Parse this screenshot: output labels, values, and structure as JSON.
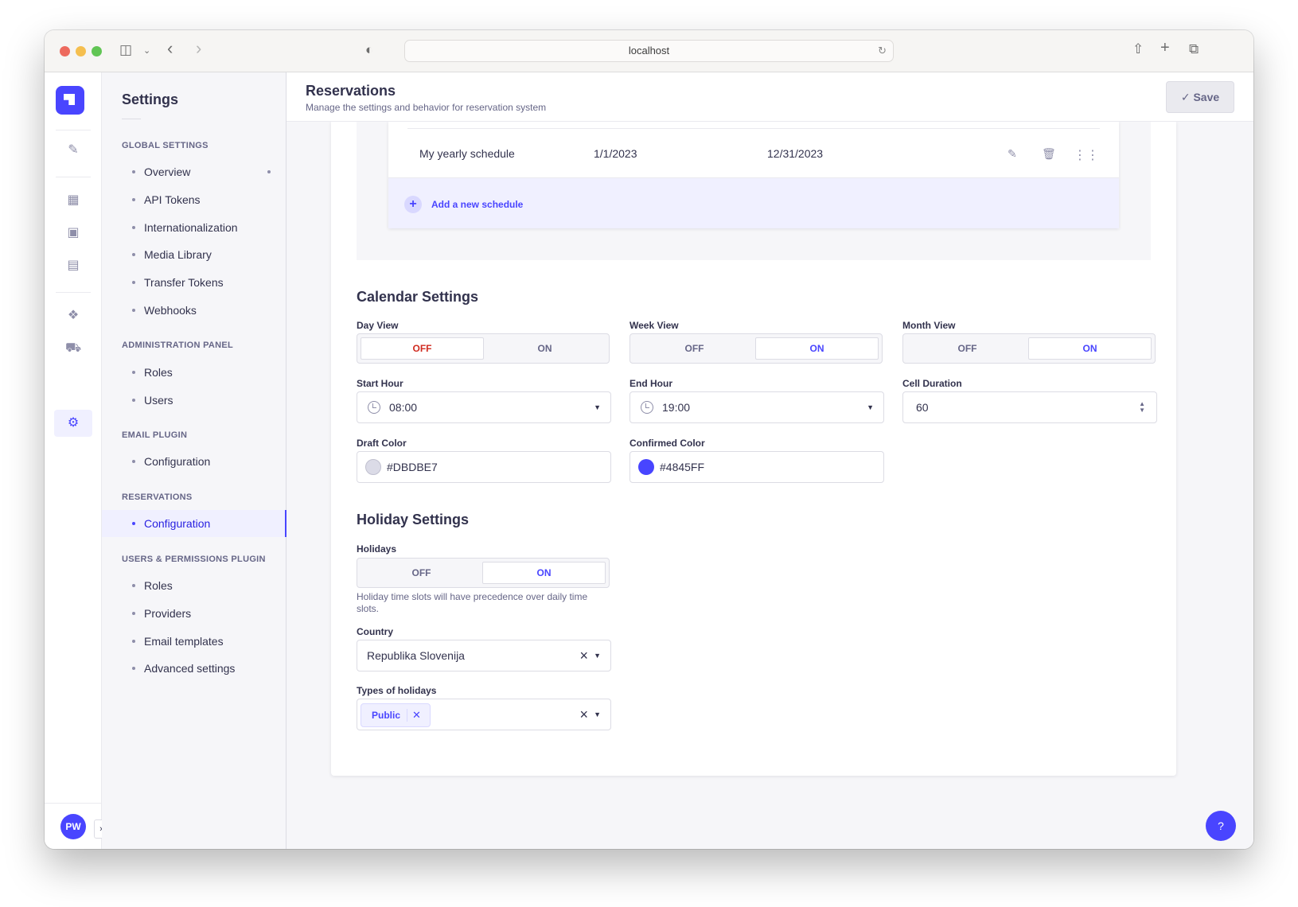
{
  "browser": {
    "url": "localhost"
  },
  "subnav": {
    "title": "Settings",
    "sections": {
      "global": "GLOBAL SETTINGS",
      "admin": "ADMINISTRATION PANEL",
      "email": "EMAIL PLUGIN",
      "reservations": "RESERVATIONS",
      "users_permissions": "USERS & PERMISSIONS PLUGIN"
    },
    "global_items": [
      "Overview",
      "API Tokens",
      "Internationalization",
      "Media Library",
      "Transfer Tokens",
      "Webhooks"
    ],
    "admin_items": [
      "Roles",
      "Users"
    ],
    "email_items": [
      "Configuration"
    ],
    "reservations_items": [
      "Configuration"
    ],
    "up_items": [
      "Roles",
      "Providers",
      "Email templates",
      "Advanced settings"
    ]
  },
  "user": {
    "initials": "PW"
  },
  "header": {
    "title": "Reservations",
    "subtitle": "Manage the settings and behavior for reservation system",
    "save_label": "Save"
  },
  "schedules": {
    "rows": [
      {
        "name": "My yearly schedule",
        "start": "1/1/2023",
        "end": "12/31/2023"
      }
    ],
    "add_label": "Add a new schedule"
  },
  "calendar": {
    "heading": "Calendar Settings",
    "day_view": {
      "label": "Day View",
      "off": "OFF",
      "on": "ON",
      "value": "OFF"
    },
    "week_view": {
      "label": "Week View",
      "off": "OFF",
      "on": "ON",
      "value": "ON"
    },
    "month_view": {
      "label": "Month View",
      "off": "OFF",
      "on": "ON",
      "value": "ON"
    },
    "start_hour": {
      "label": "Start Hour",
      "value": "08:00"
    },
    "end_hour": {
      "label": "End Hour",
      "value": "19:00"
    },
    "cell_duration": {
      "label": "Cell Duration",
      "value": "60"
    },
    "draft_color": {
      "label": "Draft Color",
      "value": "#DBDBE7"
    },
    "confirmed_color": {
      "label": "Confirmed Color",
      "value": "#4845FF"
    }
  },
  "holiday": {
    "heading": "Holiday Settings",
    "holidays": {
      "label": "Holidays",
      "off": "OFF",
      "on": "ON",
      "value": "ON"
    },
    "hint": "Holiday time slots will have precedence over daily time slots.",
    "country": {
      "label": "Country",
      "value": "Republika Slovenija"
    },
    "types": {
      "label": "Types of holidays",
      "tags": [
        "Public"
      ]
    }
  },
  "help": {
    "label": "?"
  },
  "colors": {
    "accent": "#4945ff",
    "draft": "#DBDBE7",
    "confirmed": "#4845FF",
    "danger": "#d02b20"
  }
}
